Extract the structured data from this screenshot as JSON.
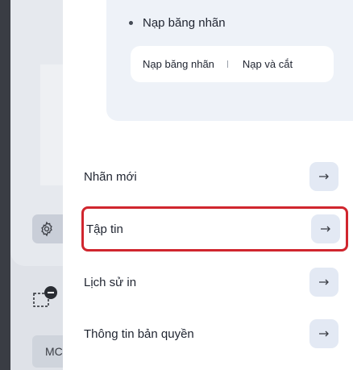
{
  "background": {
    "mc_chip_text": "MC"
  },
  "print_options": {
    "bullet_label": "Nạp băng nhãn",
    "segment_options": [
      "Nạp băng nhãn",
      "Nạp và cắt"
    ]
  },
  "menu": {
    "items": [
      {
        "label": "Nhãn mới",
        "highlighted": false
      },
      {
        "label": "Tập tin",
        "highlighted": true
      },
      {
        "label": "Lịch sử in",
        "highlighted": false
      },
      {
        "label": "Thông tin bản quyền",
        "highlighted": false
      }
    ],
    "arrow_icon": "arrow-right-icon"
  },
  "colors": {
    "highlight": "#d0262e",
    "button_bg": "#e3e9f4",
    "card_bg": "#eef2f8"
  }
}
